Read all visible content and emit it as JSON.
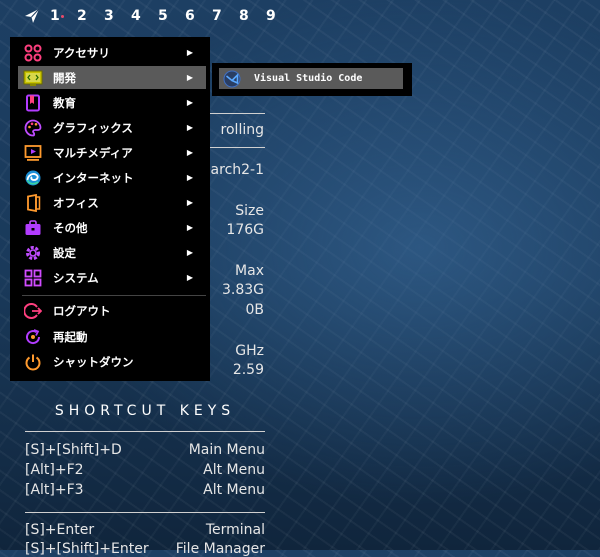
{
  "topbar": {
    "launcher_icon": "paper-plane-icon",
    "workspaces": [
      "1",
      "2",
      "3",
      "4",
      "5",
      "6",
      "7",
      "8",
      "9"
    ],
    "active_workspace": "1"
  },
  "sysinfo": {
    "release": "rolling",
    "kernel": "-arch2-1",
    "disk_header": "Size",
    "disk_size": "176G",
    "mem_header": "Max",
    "mem_max": "3.83G",
    "swap_max": "0B",
    "cpu_header": "GHz",
    "cpu_freq": "2.59"
  },
  "shortcuts": {
    "title": "SHORTCUT KEYS",
    "rows": [
      {
        "keys": "[S]+[Shift]+D",
        "action": "Main Menu"
      },
      {
        "keys": "[Alt]+F2",
        "action": "Alt Menu"
      },
      {
        "keys": "[Alt]+F3",
        "action": "Alt Menu"
      },
      {
        "keys": "[S]+Enter",
        "action": "Terminal"
      },
      {
        "keys": "[S]+[Shift]+Enter",
        "action": "File Manager"
      }
    ]
  },
  "menu": {
    "items": [
      {
        "label": "アクセサリ",
        "icon": "accessories-icon",
        "arrow": "▶"
      },
      {
        "label": "開発",
        "icon": "development-icon",
        "arrow": "▶"
      },
      {
        "label": "教育",
        "icon": "education-icon",
        "arrow": "▶"
      },
      {
        "label": "グラフィックス",
        "icon": "graphics-icon",
        "arrow": "▶"
      },
      {
        "label": "マルチメディア",
        "icon": "multimedia-icon",
        "arrow": "▶"
      },
      {
        "label": "インターネット",
        "icon": "internet-icon",
        "arrow": "▶"
      },
      {
        "label": "オフィス",
        "icon": "office-icon",
        "arrow": "▶"
      },
      {
        "label": "その他",
        "icon": "other-icon",
        "arrow": "▶"
      },
      {
        "label": "設定",
        "icon": "settings-icon",
        "arrow": "▶"
      },
      {
        "label": "システム",
        "icon": "system-icon",
        "arrow": "▶"
      }
    ],
    "actions": [
      {
        "label": "ログアウト",
        "icon": "logout-icon"
      },
      {
        "label": "再起動",
        "icon": "reboot-icon"
      },
      {
        "label": "シャットダウン",
        "icon": "shutdown-icon"
      }
    ],
    "selected": "開発"
  },
  "submenu": {
    "items": [
      {
        "label": "Visual Studio Code",
        "icon": "vscode-icon"
      }
    ]
  },
  "colors": {
    "accent_pink": "#ff3f7f",
    "accent_orange": "#ff9a2e",
    "accent_purple": "#b23cff",
    "selection": "#5a5a5a"
  }
}
